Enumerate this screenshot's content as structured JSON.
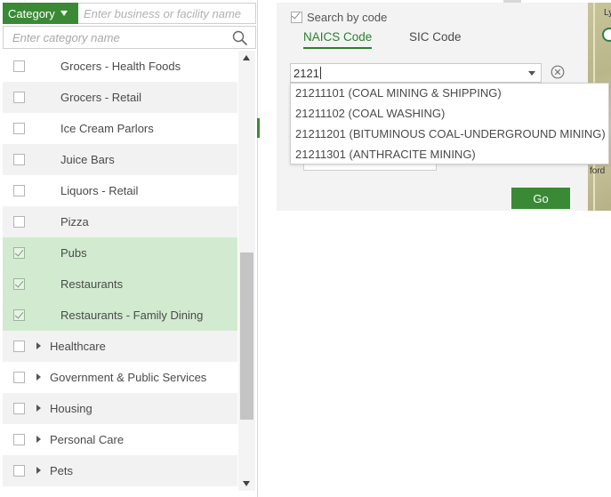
{
  "filter_bar": {
    "category_label": "Category",
    "business_placeholder": "Enter business or facility name"
  },
  "category_search": {
    "placeholder": "Enter category name"
  },
  "category_list": [
    {
      "label": "Grocers - Health Foods",
      "checked": false,
      "selected": false,
      "group": false
    },
    {
      "label": "Grocers - Retail",
      "checked": false,
      "selected": false,
      "group": false
    },
    {
      "label": "Ice Cream Parlors",
      "checked": false,
      "selected": false,
      "group": false
    },
    {
      "label": "Juice Bars",
      "checked": false,
      "selected": false,
      "group": false
    },
    {
      "label": "Liquors - Retail",
      "checked": false,
      "selected": false,
      "group": false
    },
    {
      "label": "Pizza",
      "checked": false,
      "selected": false,
      "group": false
    },
    {
      "label": "Pubs",
      "checked": true,
      "selected": true,
      "group": false
    },
    {
      "label": "Restaurants",
      "checked": true,
      "selected": true,
      "group": false
    },
    {
      "label": "Restaurants - Family Dining",
      "checked": true,
      "selected": true,
      "group": false
    },
    {
      "label": "Healthcare",
      "checked": false,
      "selected": false,
      "group": true
    },
    {
      "label": "Government & Public Services",
      "checked": false,
      "selected": false,
      "group": true
    },
    {
      "label": "Housing",
      "checked": false,
      "selected": false,
      "group": true
    },
    {
      "label": "Personal Care",
      "checked": false,
      "selected": false,
      "group": true
    },
    {
      "label": "Pets",
      "checked": false,
      "selected": false,
      "group": true
    }
  ],
  "code_search": {
    "checkbox_label": "Search by code",
    "checked": true,
    "tabs": [
      {
        "label": "NAICS Code",
        "active": true
      },
      {
        "label": "SIC Code",
        "active": false
      }
    ],
    "input_value": "2121",
    "suggestions": [
      "21211101 (COAL MINING & SHIPPING)",
      "21211102 (COAL WASHING)",
      "21211201 (BITUMINOUS COAL-UNDERGROUND MINING)",
      "21211301 (ANTHRACITE MINING)"
    ],
    "go_label": "Go"
  },
  "map": {
    "labels": [
      "Ly",
      "ford"
    ]
  },
  "colors": {
    "accent_green": "#3a8a35",
    "selected_row": "#d2ebd0",
    "alt_row": "#f2f2f2"
  }
}
